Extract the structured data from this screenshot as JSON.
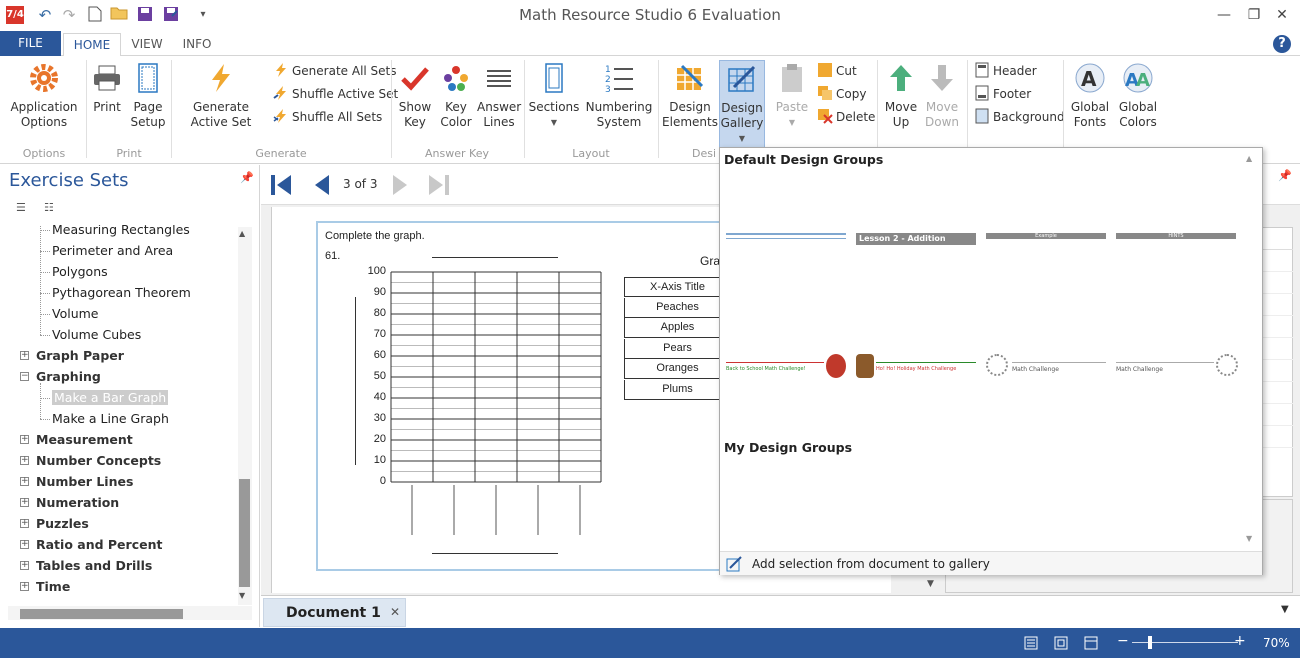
{
  "window": {
    "title": "Math Resource Studio 6 Evaluation",
    "logo": "7/4",
    "controls": {
      "minimize": "—",
      "restore": "❐",
      "close": "✕"
    }
  },
  "quick_access": [
    "undo-icon",
    "redo-icon",
    "new-icon",
    "open-icon",
    "save-icon",
    "save-as-icon",
    "customize-icon"
  ],
  "tabs": {
    "file": "FILE",
    "items": [
      {
        "label": "HOME",
        "active": true
      },
      {
        "label": "VIEW",
        "active": false
      },
      {
        "label": "INFO",
        "active": false
      }
    ],
    "help": "?"
  },
  "ribbon": {
    "groups": {
      "options": "Options",
      "print": "Print",
      "generate": "Generate",
      "answer_key": "Answer Key",
      "layout": "Layout",
      "design": "Desi"
    },
    "buttons": {
      "app_options": "Application Options",
      "print": "Print",
      "page_setup": "Page Setup",
      "generate_active": "Generate Active Set",
      "generate_all": "Generate All Sets",
      "shuffle_active": "Shuffle Active Set",
      "shuffle_all": "Shuffle All Sets",
      "show_key": "Show Key",
      "key_color": "Key Color",
      "answer_lines": "Answer Lines",
      "sections": "Sections",
      "numbering": "Numbering System",
      "design_elements": "Design Elements",
      "design_gallery": "Design Gallery",
      "paste": "Paste",
      "cut": "Cut",
      "copy": "Copy",
      "delete": "Delete",
      "move_up": "Move Up",
      "move_down": "Move Down",
      "header": "Header",
      "footer": "Footer",
      "background": "Background",
      "global_fonts": "Global Fonts",
      "global_colors": "Global Colors"
    }
  },
  "sidebar": {
    "title": "Exercise Sets",
    "tree": [
      {
        "label": "Measuring Rectangles",
        "level": 2
      },
      {
        "label": "Perimeter and Area",
        "level": 2
      },
      {
        "label": "Polygons",
        "level": 2
      },
      {
        "label": "Pythagorean Theorem",
        "level": 2
      },
      {
        "label": "Volume",
        "level": 2
      },
      {
        "label": "Volume Cubes",
        "level": 2
      },
      {
        "label": "Graph Paper",
        "level": 1,
        "expanded": false
      },
      {
        "label": "Graphing",
        "level": 1,
        "expanded": true
      },
      {
        "label": "Make a Bar Graph",
        "level": 2,
        "selected": true
      },
      {
        "label": "Make a Line Graph",
        "level": 2
      },
      {
        "label": "Measurement",
        "level": 1,
        "expanded": false
      },
      {
        "label": "Number Concepts",
        "level": 1,
        "expanded": false
      },
      {
        "label": "Number Lines",
        "level": 1,
        "expanded": false
      },
      {
        "label": "Numeration",
        "level": 1,
        "expanded": false
      },
      {
        "label": "Puzzles",
        "level": 1,
        "expanded": false
      },
      {
        "label": "Ratio and Percent",
        "level": 1,
        "expanded": false
      },
      {
        "label": "Tables and Drills",
        "level": 1,
        "expanded": false
      },
      {
        "label": "Time",
        "level": 1,
        "expanded": false
      }
    ]
  },
  "navigation": {
    "page": "3 of 3"
  },
  "worksheet": {
    "instruction": "Complete the graph.",
    "number": "61.",
    "table_title": "Graph",
    "y_ticks": [
      "100",
      "90",
      "80",
      "70",
      "60",
      "50",
      "40",
      "30",
      "20",
      "10",
      "0"
    ],
    "table_rows": [
      "X-Axis Title",
      "Peaches",
      "Apples",
      "Pears",
      "Oranges",
      "Plums"
    ]
  },
  "gallery": {
    "default_title": "Default Design Groups",
    "my_title": "My Design Groups",
    "row1": [
      {
        "name": "blue-line-design",
        "text": ""
      },
      {
        "name": "lesson-banner-design",
        "text": "Lesson 2 - Addition"
      },
      {
        "name": "example-banner-design",
        "text": "Example"
      },
      {
        "name": "hints-banner-design",
        "text": "HINTS"
      }
    ],
    "row2": [
      {
        "name": "back-to-school-design",
        "text": "Back to School Math Challenge!"
      },
      {
        "name": "holiday-design",
        "text": "Ho! Ho! Holiday Math Challenge"
      },
      {
        "name": "math-challenge-design-1",
        "text": "Math Challenge"
      },
      {
        "name": "math-challenge-design-2",
        "text": "Math Challenge"
      }
    ],
    "footer": "Add selection from document to gallery"
  },
  "document_tab": {
    "label": "Document 1",
    "close": "✕"
  },
  "status": {
    "zoom": "70%"
  },
  "colors": {
    "accent": "#2b579a",
    "selected_button": "#c5d7ee"
  }
}
